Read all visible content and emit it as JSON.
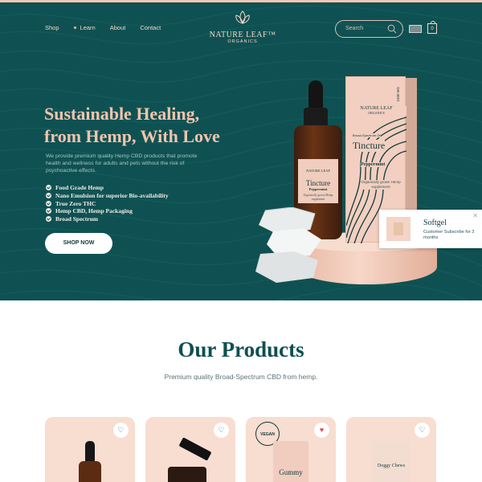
{
  "nav": {
    "items": [
      "Shop",
      "Learn",
      "About",
      "Contact"
    ],
    "active_index": 1
  },
  "logo": {
    "name": "NATURE LEAF™",
    "sub": "ORGANICS"
  },
  "search": {
    "placeholder": "Search"
  },
  "cart": {
    "count": "0"
  },
  "hero": {
    "headline_line1": "Sustainable Healing,",
    "headline_line2": "from Hemp, With Love",
    "description": "We provide premium quality Hemp CBD products that promote health and wellness for adults and pets without the risk of psychoactive effects.",
    "features": [
      "Food Grade Hemp",
      "Nano Emulsion for superior Bio-availability",
      "True Zero THC",
      "Hemp CBD, Hemp Packaging",
      "Broad Spectrum"
    ],
    "cta": "SHOP NOW"
  },
  "product_box": {
    "brand": "NATURE LEAF",
    "brand_sub": "ORGANICS",
    "volume": "1500 MG",
    "type": "Broad-Spectrum Oil",
    "title": "Tincture",
    "flavor": "Peppermint",
    "note": "Organically grown Hemp supplement"
  },
  "bottle": {
    "brand": "NATURE LEAF",
    "title": "Tincture",
    "flavor": "Peppermint",
    "note": "Organically grown Hemp supplement"
  },
  "popup": {
    "title": "Softgel",
    "text": "Customer Subscribe for 3 months"
  },
  "products": {
    "title": "Our Products",
    "subtitle": "Premium quality Broad-Spectrum CBD from hemp.",
    "cards": [
      {
        "label": "",
        "favorited": false
      },
      {
        "label": "",
        "favorited": false
      },
      {
        "label": "Gummy",
        "favorited": true,
        "badge": "VEGAN"
      },
      {
        "label": "Doggy Chews",
        "favorited": false
      }
    ]
  },
  "colors": {
    "hero_bg": "#0f5152",
    "accent": "#f2c4ad",
    "title": "#0f4f50",
    "card_bg": "#f8ddd1"
  }
}
